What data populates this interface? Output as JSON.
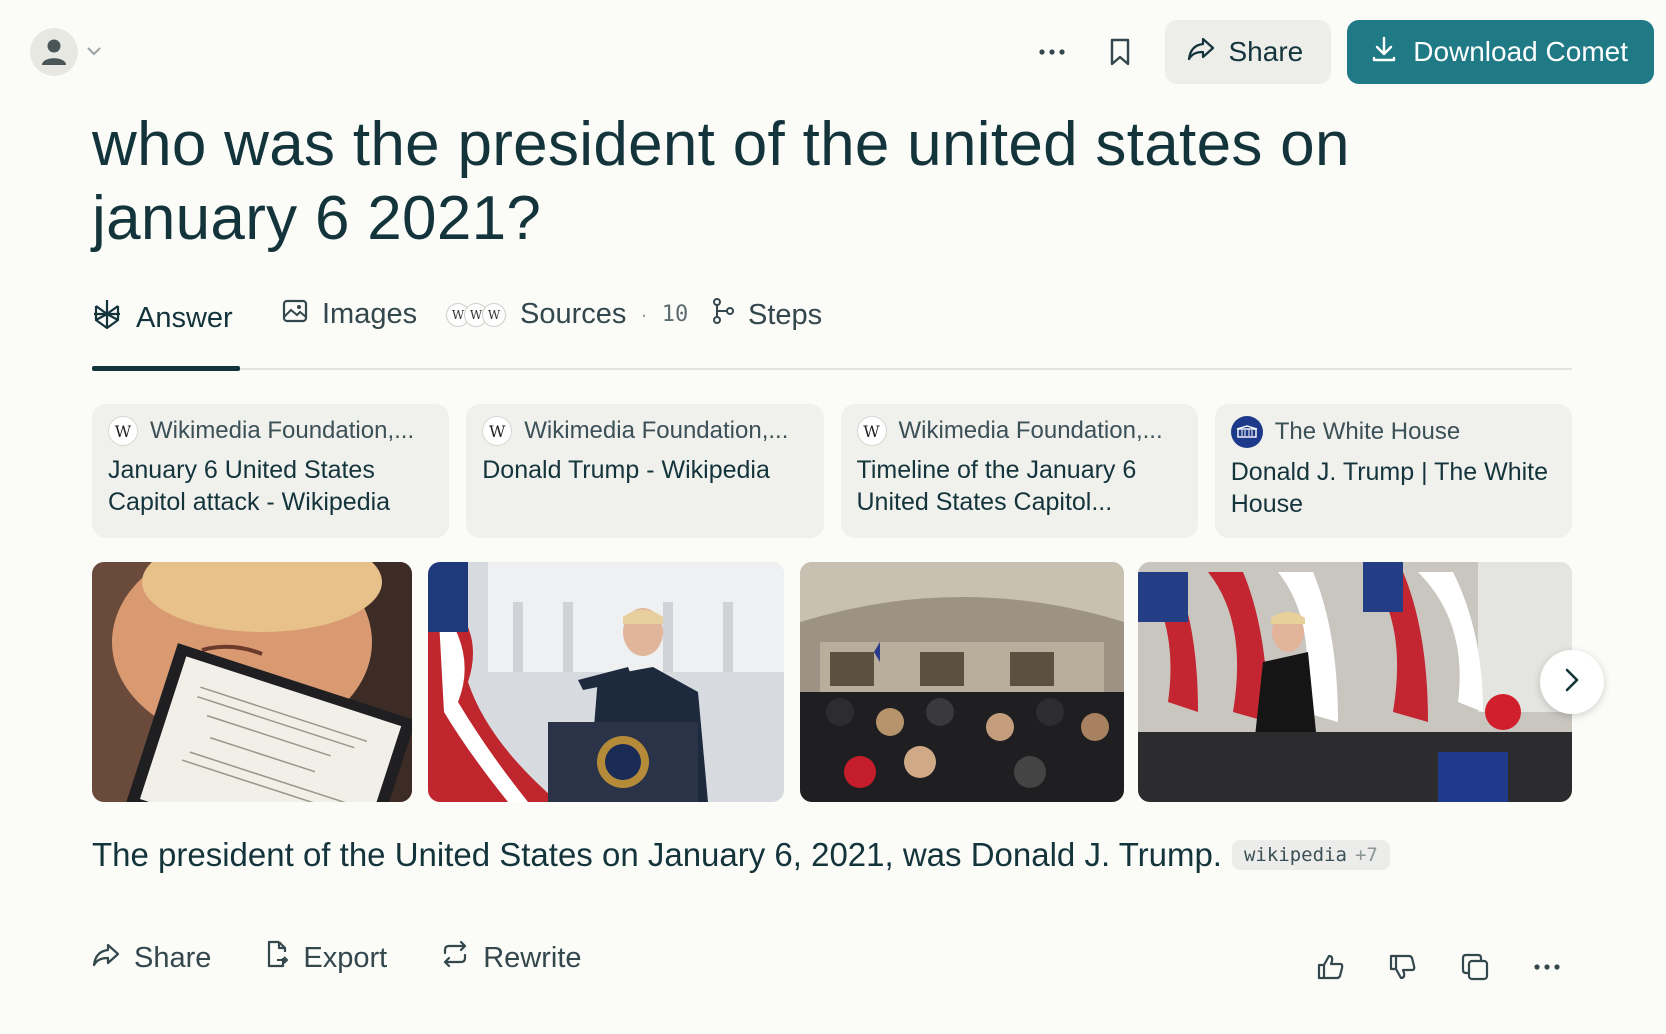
{
  "header": {
    "account_icon": "user-icon",
    "share_label": "Share",
    "download_label": "Download Comet",
    "accent_color": "#1f7a86"
  },
  "query": "who was the president of the united states on january 6 2021?",
  "tabs": [
    {
      "label": "Answer",
      "icon": "perplexity-icon",
      "active": true
    },
    {
      "label": "Images",
      "icon": "image-icon"
    },
    {
      "label": "Sources",
      "icon": "sources-icons",
      "count": "10"
    },
    {
      "label": "Steps",
      "icon": "steps-icon"
    }
  ],
  "source_cards": [
    {
      "source": "Wikimedia Foundation,...",
      "title": "January 6 United States Capitol attack - Wikipedia",
      "logo": "W"
    },
    {
      "source": "Wikimedia Foundation,...",
      "title": "Donald Trump - Wikipedia",
      "logo": "W"
    },
    {
      "source": "Wikimedia Foundation,...",
      "title": "Timeline of the January 6 United States Capitol...",
      "logo": "W"
    },
    {
      "source": "The White House",
      "title": "Donald J. Trump | The White House",
      "logo": "white-house-seal"
    }
  ],
  "answer": {
    "text": "The president of the United States on January 6, 2021, was Donald J. Trump.",
    "citation": "wikipedia",
    "citation_more": "+7"
  },
  "actions": [
    {
      "label": "Share",
      "icon": "share-icon"
    },
    {
      "label": "Export",
      "icon": "export-icon"
    },
    {
      "label": "Rewrite",
      "icon": "rewrite-icon"
    }
  ]
}
